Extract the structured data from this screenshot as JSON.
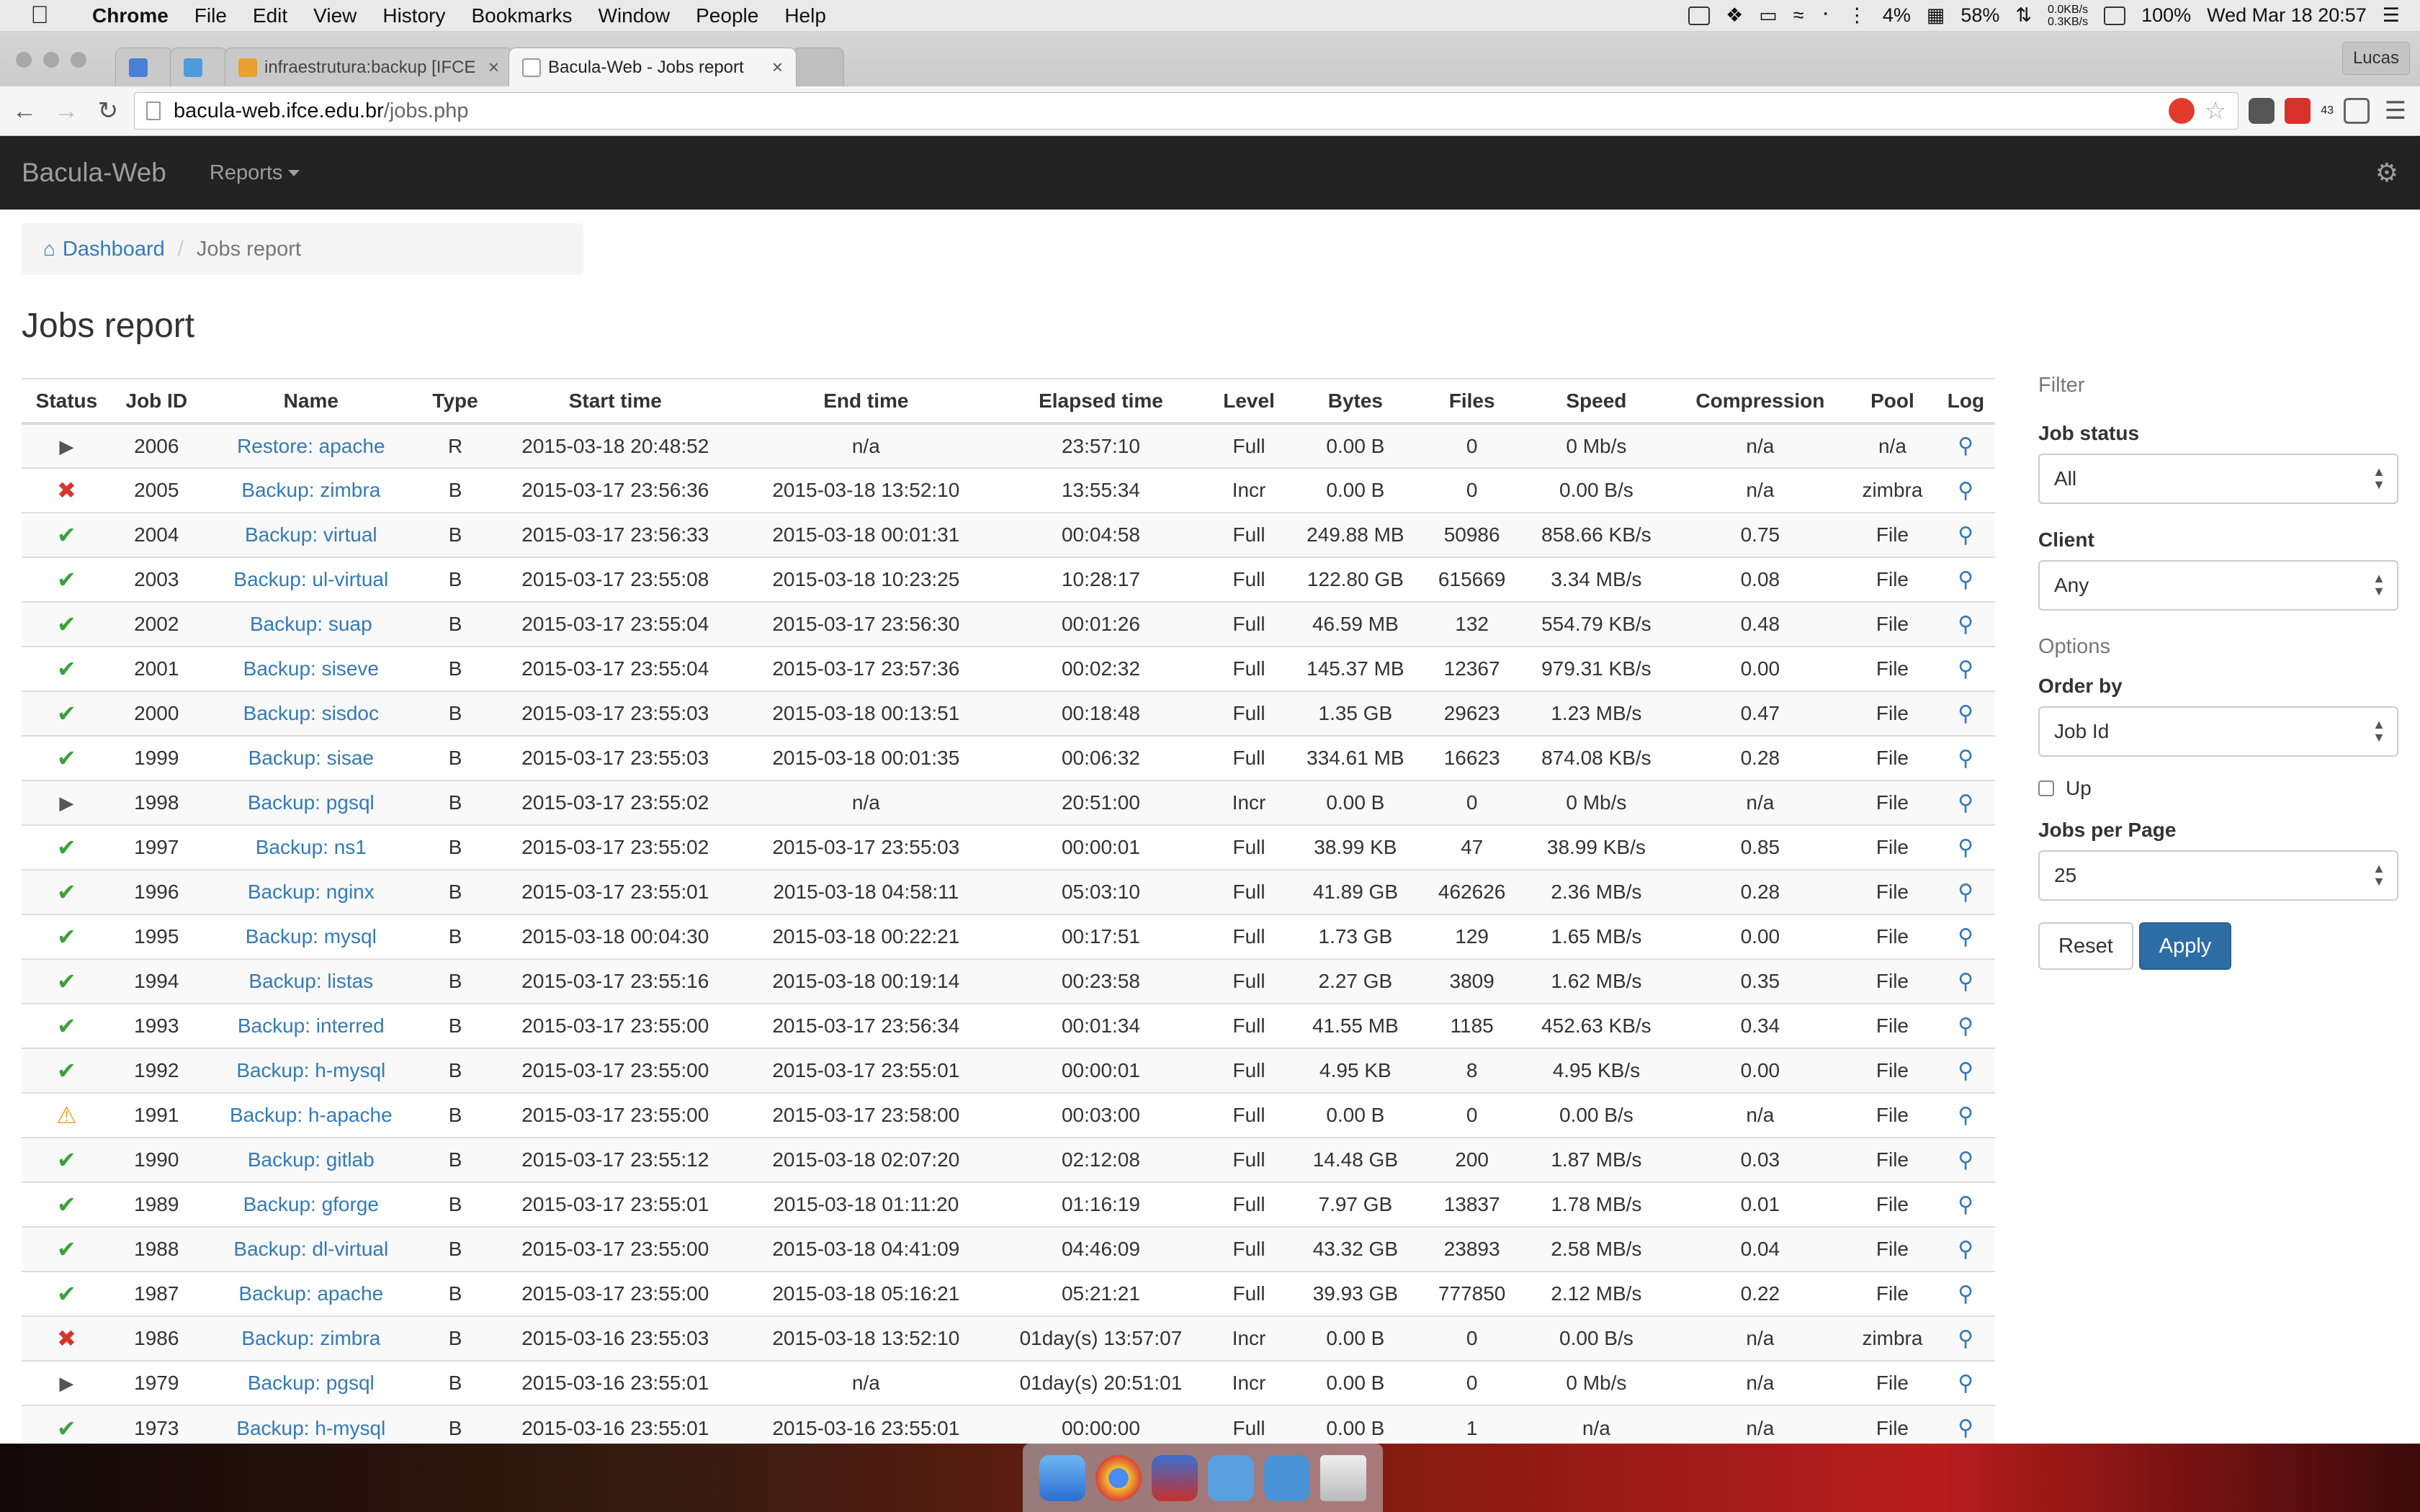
{
  "menubar": {
    "apple_icon": "apple-icon",
    "app_name": "Chrome",
    "items": [
      "File",
      "Edit",
      "View",
      "History",
      "Bookmarks",
      "Window",
      "People",
      "Help"
    ],
    "status": {
      "battery_indicator": "4%",
      "cpu": "58%",
      "net_up": "0.0KB/s",
      "net_down": "0.3KB/s",
      "battery": "100%",
      "clock": "Wed Mar 18  20:57"
    }
  },
  "browser": {
    "tabs": [
      {
        "title": ""
      },
      {
        "title": ""
      },
      {
        "title": "infraestrutura:backup [IFCE"
      },
      {
        "title": "Bacula-Web - Jobs report"
      }
    ],
    "profile": "Lucas",
    "url_host": "bacula-web.ifce.edu.br",
    "url_path": "/jobs.php",
    "ext_badge": "43"
  },
  "app": {
    "brand": "Bacula-Web",
    "nav_reports": "Reports",
    "breadcrumb_home": "Dashboard",
    "breadcrumb_current": "Jobs report",
    "title": "Jobs report"
  },
  "table": {
    "headers": [
      "Status",
      "Job ID",
      "Name",
      "Type",
      "Start time",
      "End time",
      "Elapsed time",
      "Level",
      "Bytes",
      "Files",
      "Speed",
      "Compression",
      "Pool",
      "Log"
    ],
    "rows": [
      {
        "status": "running",
        "id": "2006",
        "name": "Restore: apache",
        "type": "R",
        "start": "2015-03-18 20:48:52",
        "end": "n/a",
        "elapsed": "23:57:10",
        "level": "Full",
        "bytes": "0.00 B",
        "files": "0",
        "speed": "0 Mb/s",
        "compression": "n/a",
        "pool": "n/a"
      },
      {
        "status": "error",
        "id": "2005",
        "name": "Backup: zimbra",
        "type": "B",
        "start": "2015-03-17 23:56:36",
        "end": "2015-03-18 13:52:10",
        "elapsed": "13:55:34",
        "level": "Incr",
        "bytes": "0.00 B",
        "files": "0",
        "speed": "0.00 B/s",
        "compression": "n/a",
        "pool": "zimbra"
      },
      {
        "status": "ok",
        "id": "2004",
        "name": "Backup: virtual",
        "type": "B",
        "start": "2015-03-17 23:56:33",
        "end": "2015-03-18 00:01:31",
        "elapsed": "00:04:58",
        "level": "Full",
        "bytes": "249.88 MB",
        "files": "50986",
        "speed": "858.66 KB/s",
        "compression": "0.75",
        "pool": "File"
      },
      {
        "status": "ok",
        "id": "2003",
        "name": "Backup: ul-virtual",
        "type": "B",
        "start": "2015-03-17 23:55:08",
        "end": "2015-03-18 10:23:25",
        "elapsed": "10:28:17",
        "level": "Full",
        "bytes": "122.80 GB",
        "files": "615669",
        "speed": "3.34 MB/s",
        "compression": "0.08",
        "pool": "File"
      },
      {
        "status": "ok",
        "id": "2002",
        "name": "Backup: suap",
        "type": "B",
        "start": "2015-03-17 23:55:04",
        "end": "2015-03-17 23:56:30",
        "elapsed": "00:01:26",
        "level": "Full",
        "bytes": "46.59 MB",
        "files": "132",
        "speed": "554.79 KB/s",
        "compression": "0.48",
        "pool": "File"
      },
      {
        "status": "ok",
        "id": "2001",
        "name": "Backup: siseve",
        "type": "B",
        "start": "2015-03-17 23:55:04",
        "end": "2015-03-17 23:57:36",
        "elapsed": "00:02:32",
        "level": "Full",
        "bytes": "145.37 MB",
        "files": "12367",
        "speed": "979.31 KB/s",
        "compression": "0.00",
        "pool": "File"
      },
      {
        "status": "ok",
        "id": "2000",
        "name": "Backup: sisdoc",
        "type": "B",
        "start": "2015-03-17 23:55:03",
        "end": "2015-03-18 00:13:51",
        "elapsed": "00:18:48",
        "level": "Full",
        "bytes": "1.35 GB",
        "files": "29623",
        "speed": "1.23 MB/s",
        "compression": "0.47",
        "pool": "File"
      },
      {
        "status": "ok",
        "id": "1999",
        "name": "Backup: sisae",
        "type": "B",
        "start": "2015-03-17 23:55:03",
        "end": "2015-03-18 00:01:35",
        "elapsed": "00:06:32",
        "level": "Full",
        "bytes": "334.61 MB",
        "files": "16623",
        "speed": "874.08 KB/s",
        "compression": "0.28",
        "pool": "File"
      },
      {
        "status": "running",
        "id": "1998",
        "name": "Backup: pgsql",
        "type": "B",
        "start": "2015-03-17 23:55:02",
        "end": "n/a",
        "elapsed": "20:51:00",
        "level": "Incr",
        "bytes": "0.00 B",
        "files": "0",
        "speed": "0 Mb/s",
        "compression": "n/a",
        "pool": "File"
      },
      {
        "status": "ok",
        "id": "1997",
        "name": "Backup: ns1",
        "type": "B",
        "start": "2015-03-17 23:55:02",
        "end": "2015-03-17 23:55:03",
        "elapsed": "00:00:01",
        "level": "Full",
        "bytes": "38.99 KB",
        "files": "47",
        "speed": "38.99 KB/s",
        "compression": "0.85",
        "pool": "File"
      },
      {
        "status": "ok",
        "id": "1996",
        "name": "Backup: nginx",
        "type": "B",
        "start": "2015-03-17 23:55:01",
        "end": "2015-03-18 04:58:11",
        "elapsed": "05:03:10",
        "level": "Full",
        "bytes": "41.89 GB",
        "files": "462626",
        "speed": "2.36 MB/s",
        "compression": "0.28",
        "pool": "File"
      },
      {
        "status": "ok",
        "id": "1995",
        "name": "Backup: mysql",
        "type": "B",
        "start": "2015-03-18 00:04:30",
        "end": "2015-03-18 00:22:21",
        "elapsed": "00:17:51",
        "level": "Full",
        "bytes": "1.73 GB",
        "files": "129",
        "speed": "1.65 MB/s",
        "compression": "0.00",
        "pool": "File"
      },
      {
        "status": "ok",
        "id": "1994",
        "name": "Backup: listas",
        "type": "B",
        "start": "2015-03-17 23:55:16",
        "end": "2015-03-18 00:19:14",
        "elapsed": "00:23:58",
        "level": "Full",
        "bytes": "2.27 GB",
        "files": "3809",
        "speed": "1.62 MB/s",
        "compression": "0.35",
        "pool": "File"
      },
      {
        "status": "ok",
        "id": "1993",
        "name": "Backup: interred",
        "type": "B",
        "start": "2015-03-17 23:55:00",
        "end": "2015-03-17 23:56:34",
        "elapsed": "00:01:34",
        "level": "Full",
        "bytes": "41.55 MB",
        "files": "1185",
        "speed": "452.63 KB/s",
        "compression": "0.34",
        "pool": "File"
      },
      {
        "status": "ok",
        "id": "1992",
        "name": "Backup: h-mysql",
        "type": "B",
        "start": "2015-03-17 23:55:00",
        "end": "2015-03-17 23:55:01",
        "elapsed": "00:00:01",
        "level": "Full",
        "bytes": "4.95 KB",
        "files": "8",
        "speed": "4.95 KB/s",
        "compression": "0.00",
        "pool": "File"
      },
      {
        "status": "warning",
        "id": "1991",
        "name": "Backup: h-apache",
        "type": "B",
        "start": "2015-03-17 23:55:00",
        "end": "2015-03-17 23:58:00",
        "elapsed": "00:03:00",
        "level": "Full",
        "bytes": "0.00 B",
        "files": "0",
        "speed": "0.00 B/s",
        "compression": "n/a",
        "pool": "File"
      },
      {
        "status": "ok",
        "id": "1990",
        "name": "Backup: gitlab",
        "type": "B",
        "start": "2015-03-17 23:55:12",
        "end": "2015-03-18 02:07:20",
        "elapsed": "02:12:08",
        "level": "Full",
        "bytes": "14.48 GB",
        "files": "200",
        "speed": "1.87 MB/s",
        "compression": "0.03",
        "pool": "File"
      },
      {
        "status": "ok",
        "id": "1989",
        "name": "Backup: gforge",
        "type": "B",
        "start": "2015-03-17 23:55:01",
        "end": "2015-03-18 01:11:20",
        "elapsed": "01:16:19",
        "level": "Full",
        "bytes": "7.97 GB",
        "files": "13837",
        "speed": "1.78 MB/s",
        "compression": "0.01",
        "pool": "File"
      },
      {
        "status": "ok",
        "id": "1988",
        "name": "Backup: dl-virtual",
        "type": "B",
        "start": "2015-03-17 23:55:00",
        "end": "2015-03-18 04:41:09",
        "elapsed": "04:46:09",
        "level": "Full",
        "bytes": "43.32 GB",
        "files": "23893",
        "speed": "2.58 MB/s",
        "compression": "0.04",
        "pool": "File"
      },
      {
        "status": "ok",
        "id": "1987",
        "name": "Backup: apache",
        "type": "B",
        "start": "2015-03-17 23:55:00",
        "end": "2015-03-18 05:16:21",
        "elapsed": "05:21:21",
        "level": "Full",
        "bytes": "39.93 GB",
        "files": "777850",
        "speed": "2.12 MB/s",
        "compression": "0.22",
        "pool": "File"
      },
      {
        "status": "error",
        "id": "1986",
        "name": "Backup: zimbra",
        "type": "B",
        "start": "2015-03-16 23:55:03",
        "end": "2015-03-18 13:52:10",
        "elapsed": "01day(s) 13:57:07",
        "level": "Incr",
        "bytes": "0.00 B",
        "files": "0",
        "speed": "0.00 B/s",
        "compression": "n/a",
        "pool": "zimbra"
      },
      {
        "status": "running",
        "id": "1979",
        "name": "Backup: pgsql",
        "type": "B",
        "start": "2015-03-16 23:55:01",
        "end": "n/a",
        "elapsed": "01day(s) 20:51:01",
        "level": "Incr",
        "bytes": "0.00 B",
        "files": "0",
        "speed": "0 Mb/s",
        "compression": "n/a",
        "pool": "File"
      },
      {
        "status": "ok",
        "id": "1973",
        "name": "Backup: h-mysql",
        "type": "B",
        "start": "2015-03-16 23:55:01",
        "end": "2015-03-16 23:55:01",
        "elapsed": "00:00:00",
        "level": "Full",
        "bytes": "0.00 B",
        "files": "1",
        "speed": "n/a",
        "compression": "n/a",
        "pool": "File"
      }
    ]
  },
  "filter": {
    "legend": "Filter",
    "job_status_label": "Job status",
    "job_status_value": "All",
    "client_label": "Client",
    "client_value": "Any",
    "options_legend": "Options",
    "order_by_label": "Order by",
    "order_by_value": "Job Id",
    "up_label": "Up",
    "jobs_per_page_label": "Jobs per Page",
    "jobs_per_page_value": "25",
    "reset_label": "Reset",
    "apply_label": "Apply"
  },
  "colors": {
    "navbar": "#222222",
    "link": "#337ab7",
    "ok": "#3aa13a",
    "error": "#d9342b",
    "warning": "#f0a020",
    "primary_button": "#2e6da4"
  }
}
